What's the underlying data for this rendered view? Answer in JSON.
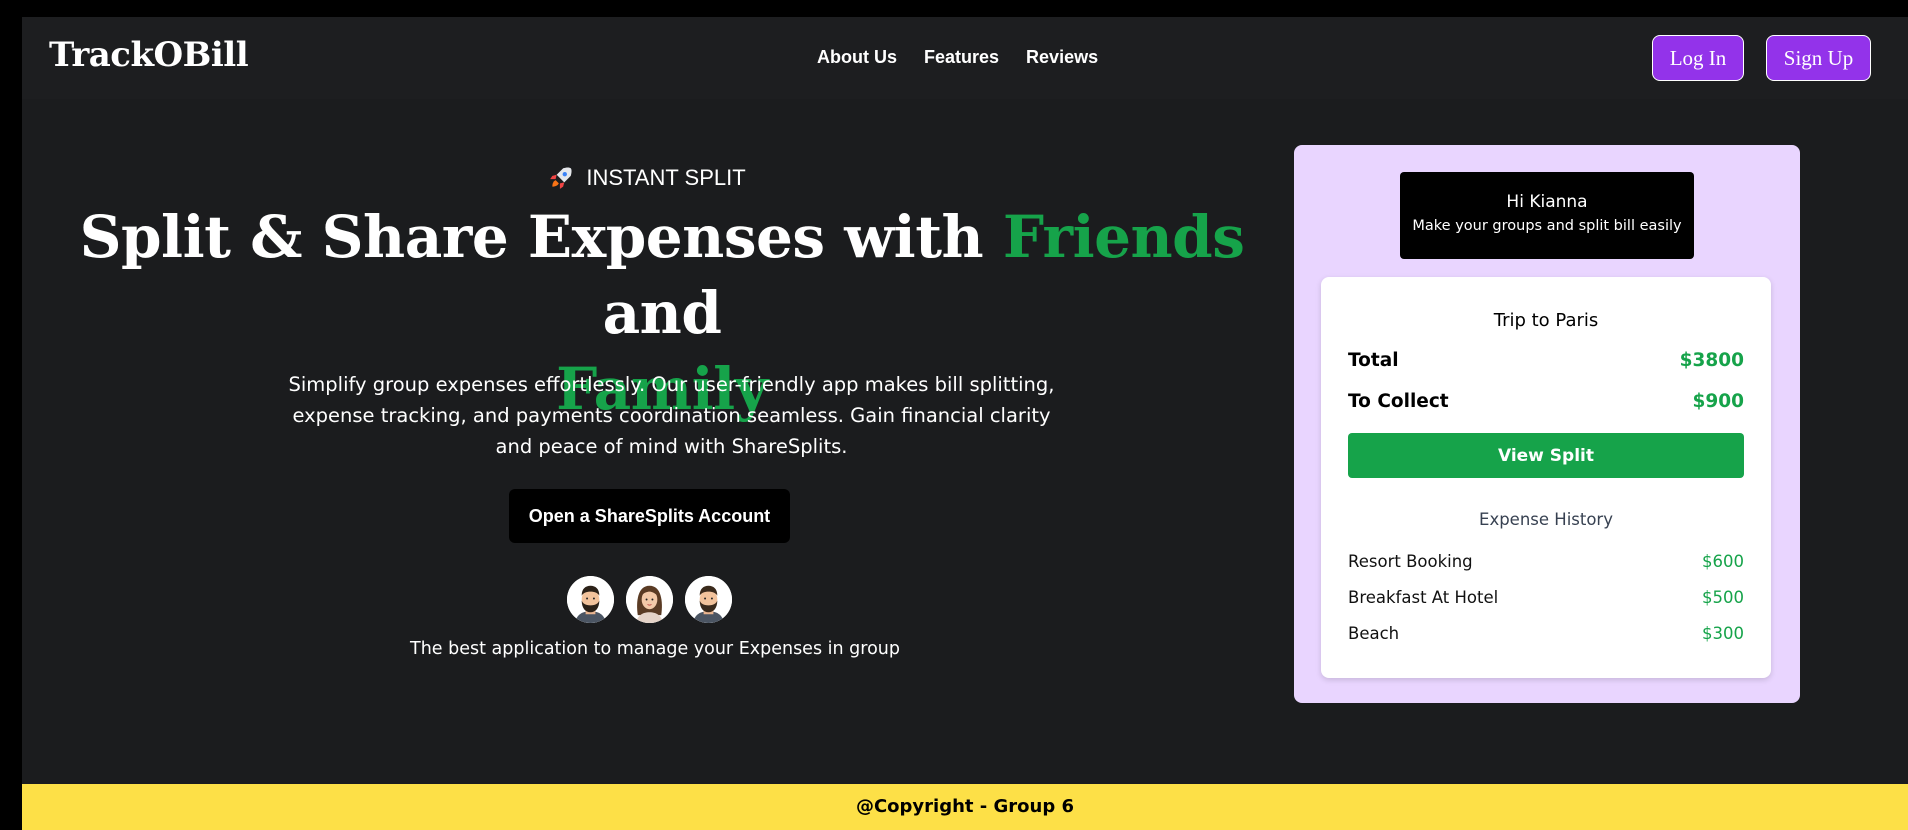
{
  "brand": {
    "logo": "TrackOBill"
  },
  "nav": {
    "items": [
      "About Us",
      "Features",
      "Reviews"
    ]
  },
  "auth": {
    "login": "Log In",
    "signup": "Sign Up"
  },
  "hero": {
    "badge": "INSTANT SPLIT",
    "badge_icon": "rocket-icon",
    "headline_part1": "Split & Share Expenses with ",
    "headline_highlight1": "Friends",
    "headline_part2": " and ",
    "headline_highlight2": "Family",
    "subtext": "Simplify group expenses effortlessly. Our user-friendly app makes bill splitting, expense tracking, and payments coordination seamless. Gain financial clarity and peace of mind with ShareSplits.",
    "cta": "Open a ShareSplits Account",
    "tagline": "The best application to manage your Expenses in group"
  },
  "card": {
    "greeting": "Hi Kianna",
    "greeting_sub": "Make your groups and split bill easily",
    "trip_title": "Trip to Paris",
    "total_label": "Total",
    "total_value": "$3800",
    "collect_label": "To Collect",
    "collect_value": "$900",
    "view_split": "View Split",
    "history_title": "Expense History",
    "history": [
      {
        "name": "Resort Booking",
        "amount": "$600"
      },
      {
        "name": "Breakfast At Hotel",
        "amount": "$500"
      },
      {
        "name": "Beach",
        "amount": "$300"
      }
    ]
  },
  "footer": {
    "text": "@Copyright - Group 6"
  },
  "colors": {
    "accent_green": "#16a34a",
    "accent_purple": "#9333ea",
    "card_bg": "#e9d5ff",
    "footer_bg": "#fde047",
    "page_bg": "#1b1c1e"
  }
}
